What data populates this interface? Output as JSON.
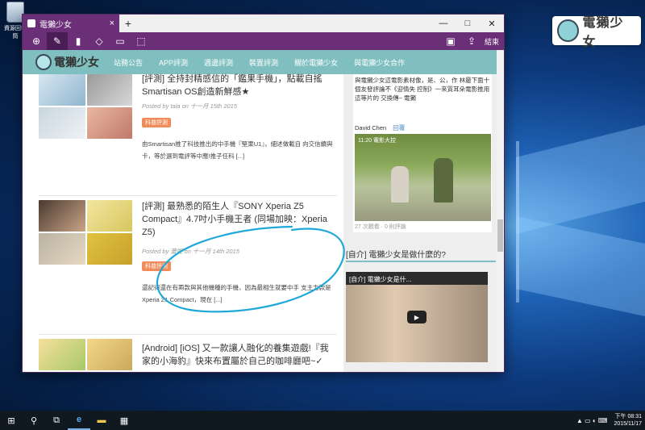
{
  "desktop": {
    "recycle_bin_label": "資源回收筒",
    "brand_logo_text": "電獺少女"
  },
  "browser": {
    "tab_title": "電獺少女",
    "tab_close": "×",
    "new_tab": "+",
    "controls": {
      "minimize": "—",
      "maximize": "□",
      "close": "✕"
    },
    "toolbar": {
      "pan_icon": "⊕",
      "pen_icon": "✎",
      "highlighter_icon": "▮",
      "eraser_icon": "◇",
      "comment_icon": "▭",
      "clip_icon": "⬚",
      "save_icon": "▣",
      "share_icon": "⇪",
      "exit_label": "結束"
    }
  },
  "site": {
    "logo_name": "電獺少女",
    "nav": [
      "站務公告",
      "APP評測",
      "週邊評測",
      "裝置評測",
      "關於電獺少女",
      "與電獺少女合作"
    ]
  },
  "articles": [
    {
      "title": "[評測] 全持封精感信的「鑑果手機」，點載自搖 Smartisan OS創造新鮮感★",
      "meta": "Posted by tala on 十一月 15th 2015",
      "tag": "科普評測",
      "excerpt": "由Smartisan推了科技推出的中手機『堅果U1』，細述做載自 向交信續與卡，等於選到電評等中應!推子任科 [...]"
    },
    {
      "title": "[評測] 最熟悉的陌生人『SONY Xperia Z5 Compact』4.7吋小手機王者 (同場加映：Xperia Z5)",
      "meta": "Posted by 蕾妮 on 十一月 14th 2015",
      "tag": "科普評測",
      "excerpt": "還記得還在有兩款與其他機種的手機，因為最相生就要中手 支主力款是Xperia Z1 Compact，現在 [...]"
    },
    {
      "title": "[Android] [iOS] 又一款讓人融化的養集遊戲!『我家的小海豹』快來布置屬於自己的咖啡廳吧~✓",
      "meta": "",
      "tag": "",
      "excerpt": ""
    }
  ],
  "sidebar": {
    "comment_text": "與電獺少女這電影素材像，是、公，作 林最下面十個友發評論不《迎情失 控制》一來質耳朵電影推用這等片的 交換傳~ 電獺",
    "comment_author": "David Chen",
    "reply_label": "回覆",
    "photo_stamp": "11:20 電影大控",
    "photo_stats": "27 次觀看 · 0 則評論",
    "heading": "[自介] 電獺少女是做什麼的?",
    "video_title": "[自介] 電獺少女是什..."
  },
  "taskbar": {
    "start_icon": "⊞",
    "search_icon": "⚲",
    "taskview_icon": "⧉",
    "edge_icon": "e",
    "explorer_icon": "▬",
    "store_icon": "▦",
    "tray_icons": "▲ ▭ ◐ ⌨",
    "time": "下午 08:31",
    "date": "2015/11/17"
  }
}
